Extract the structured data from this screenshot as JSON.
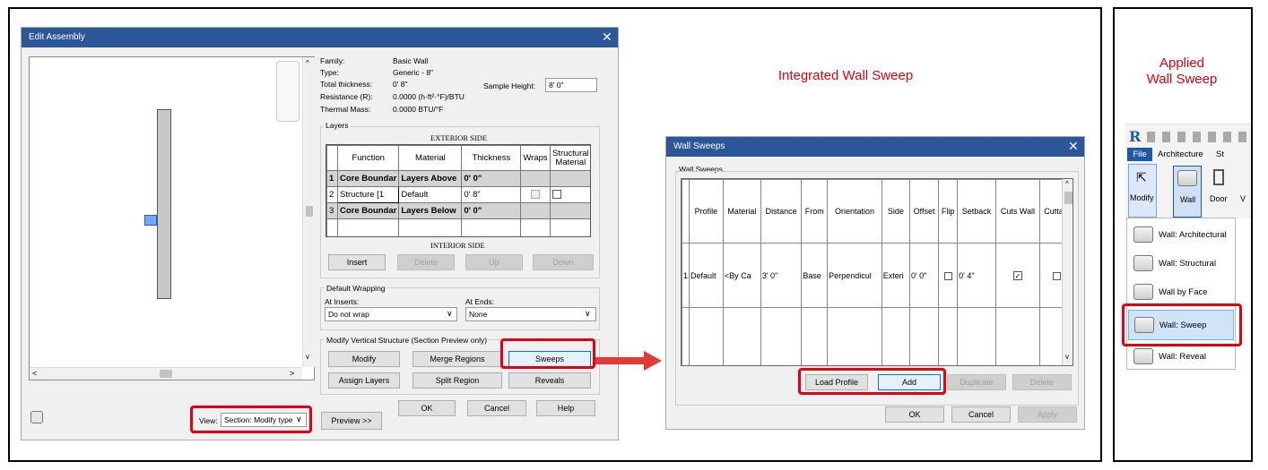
{
  "edit_assembly": {
    "title": "Edit Assembly",
    "family_label": "Family:",
    "family_value": "Basic Wall",
    "type_label": "Type:",
    "type_value": "Generic - 8\"",
    "thickness_label": "Total thickness:",
    "thickness_value": "0'  8\"",
    "resistance_label": "Resistance (R):",
    "resistance_value": "0.0000 (h·ft²·°F)/BTU",
    "mass_label": "Thermal Mass:",
    "mass_value": "0.0000 BTU/°F",
    "sample_height_label": "Sample Height:",
    "sample_height_value": "8'  0\"",
    "layers_label": "Layers",
    "exterior_side": "EXTERIOR SIDE",
    "interior_side": "INTERIOR SIDE",
    "columns": [
      "",
      "Function",
      "Material",
      "Thickness",
      "Wraps",
      "Structural Material"
    ],
    "rows": [
      {
        "n": "1",
        "function": "Core Boundar",
        "material": "Layers Above",
        "thickness": "0'  0\""
      },
      {
        "n": "2",
        "function": "Structure [1",
        "material": "Default",
        "thickness": "0'  8\""
      },
      {
        "n": "3",
        "function": "Core Boundar",
        "material": "Layers Below",
        "thickness": "0'  0\""
      }
    ],
    "insert": "Insert",
    "delete": "Delete",
    "up": "Up",
    "down": "Down",
    "default_wrapping": "Default Wrapping",
    "at_inserts_label": "At Inserts:",
    "at_inserts_value": "Do not wrap",
    "at_ends_label": "At Ends:",
    "at_ends_value": "None",
    "modify_vertical": "Modify Vertical Structure (Section Preview only)",
    "modify": "Modify",
    "merge_regions": "Merge Regions",
    "sweeps": "Sweeps",
    "assign_layers": "Assign Layers",
    "split_region": "Split Region",
    "reveals": "Reveals",
    "ok": "OK",
    "cancel": "Cancel",
    "help": "Help",
    "view_label": "View:",
    "view_value": "Section: Modify type",
    "preview": "Preview >>"
  },
  "integrated_label": "Integrated Wall Sweep",
  "applied_label_1": "Applied",
  "applied_label_2": "Wall Sweep",
  "wall_sweeps": {
    "title": "Wall Sweeps",
    "group": "Wall Sweeps",
    "columns": [
      "",
      "Profile",
      "Material",
      "Distance",
      "From",
      "Orientation",
      "Side",
      "Offset",
      "Flip",
      "Setback",
      "Cuts Wall",
      "Cuttabl"
    ],
    "row": {
      "n": "1",
      "profile": "Default",
      "material": "<By Ca",
      "distance": "3'  0\"",
      "from": "Base",
      "orientation": "Perpendicul",
      "side": "Exteri",
      "offset": "0'  0\"",
      "setback": "0'  4\""
    },
    "load_profile": "Load Profile",
    "add": "Add",
    "duplicate": "Duplicate",
    "delete": "Delete",
    "ok": "OK",
    "cancel": "Cancel",
    "apply": "Apply"
  },
  "ribbon": {
    "file": "File",
    "architecture": "Architecture",
    "st": "St",
    "modify": "Modify",
    "wall": "Wall",
    "door": "Door",
    "v": "V",
    "menu": [
      "Wall: Architectural",
      "Wall: Structural",
      "Wall by Face",
      "Wall: Sweep",
      "Wall: Reveal"
    ]
  },
  "colors": {
    "highlight": "#e3000f",
    "titlebar": "#2b579a"
  }
}
